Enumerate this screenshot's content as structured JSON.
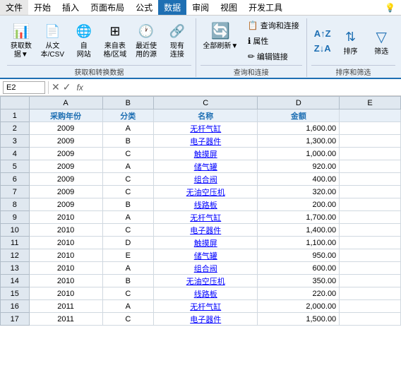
{
  "menubar": {
    "items": [
      "文件",
      "开始",
      "插入",
      "页面布局",
      "公式",
      "数据",
      "审阅",
      "视图",
      "开发工具"
    ]
  },
  "ribbon": {
    "groups": [
      {
        "label": "获取和转换数据",
        "buttons": [
          {
            "id": "get-data",
            "icon": "📊",
            "label": "获取数\n据▼"
          },
          {
            "id": "from-text",
            "icon": "📄",
            "label": "从文\n本/CSV"
          },
          {
            "id": "from-web",
            "icon": "🌐",
            "label": "自\n网站"
          },
          {
            "id": "from-table",
            "icon": "⬜",
            "label": "来自表\n格/区域"
          },
          {
            "id": "recent-sources",
            "icon": "🕐",
            "label": "最近使\n用的源"
          },
          {
            "id": "existing-conn",
            "icon": "🔗",
            "label": "现有\n连接"
          }
        ]
      },
      {
        "label": "查询和连接",
        "buttons": [
          {
            "id": "refresh-all",
            "icon": "🔄",
            "label": "全部刷新\n▼"
          },
          {
            "id": "queries-conn",
            "icon": "📋",
            "label": "查询和连接"
          },
          {
            "id": "properties",
            "icon": "ℹ",
            "label": "属性"
          },
          {
            "id": "edit-links",
            "icon": "✏",
            "label": "编辑链接"
          }
        ]
      },
      {
        "label": "排序和筛选",
        "buttons": [
          {
            "id": "sort-az",
            "icon": "↑",
            "label": "AZ"
          },
          {
            "id": "sort-za",
            "icon": "↓",
            "label": "ZA"
          },
          {
            "id": "sort",
            "icon": "⬛",
            "label": "排序"
          },
          {
            "id": "filter",
            "icon": "▽",
            "label": "筛选"
          }
        ]
      }
    ]
  },
  "formula_bar": {
    "cell_ref": "E2",
    "formula": ""
  },
  "sheet": {
    "col_headers": [
      "",
      "A",
      "B",
      "C",
      "D",
      "E"
    ],
    "rows": [
      {
        "row_num": "1",
        "A": "采购年份",
        "B": "分类",
        "C": "名称",
        "D": "金额",
        "E": "",
        "type": "header"
      },
      {
        "row_num": "2",
        "A": "2009",
        "B": "A",
        "C": "无杆气缸",
        "D": "1,600.00",
        "E": "",
        "type": "data"
      },
      {
        "row_num": "3",
        "A": "2009",
        "B": "B",
        "C": "电子器件",
        "D": "1,300.00",
        "E": "",
        "type": "data"
      },
      {
        "row_num": "4",
        "A": "2009",
        "B": "C",
        "C": "触摸屏",
        "D": "1,000.00",
        "E": "",
        "type": "data"
      },
      {
        "row_num": "5",
        "A": "2009",
        "B": "A",
        "C": "储气罐",
        "D": "920.00",
        "E": "",
        "type": "data"
      },
      {
        "row_num": "6",
        "A": "2009",
        "B": "C",
        "C": "组合阀",
        "D": "400.00",
        "E": "",
        "type": "data"
      },
      {
        "row_num": "7",
        "A": "2009",
        "B": "C",
        "C": "无油空压机",
        "D": "320.00",
        "E": "",
        "type": "data"
      },
      {
        "row_num": "8",
        "A": "2009",
        "B": "B",
        "C": "线路板",
        "D": "200.00",
        "E": "",
        "type": "data"
      },
      {
        "row_num": "9",
        "A": "2010",
        "B": "A",
        "C": "无杆气缸",
        "D": "1,700.00",
        "E": "",
        "type": "data"
      },
      {
        "row_num": "10",
        "A": "2010",
        "B": "C",
        "C": "电子器件",
        "D": "1,400.00",
        "E": "",
        "type": "data"
      },
      {
        "row_num": "11",
        "A": "2010",
        "B": "D",
        "C": "触摸屏",
        "D": "1,100.00",
        "E": "",
        "type": "data"
      },
      {
        "row_num": "12",
        "A": "2010",
        "B": "E",
        "C": "储气罐",
        "D": "950.00",
        "E": "",
        "type": "data"
      },
      {
        "row_num": "13",
        "A": "2010",
        "B": "A",
        "C": "组合阀",
        "D": "600.00",
        "E": "",
        "type": "data"
      },
      {
        "row_num": "14",
        "A": "2010",
        "B": "B",
        "C": "无油空压机",
        "D": "350.00",
        "E": "",
        "type": "data"
      },
      {
        "row_num": "15",
        "A": "2010",
        "B": "C",
        "C": "线路板",
        "D": "220.00",
        "E": "",
        "type": "data"
      },
      {
        "row_num": "16",
        "A": "2011",
        "B": "A",
        "C": "无杆气缸",
        "D": "2,000.00",
        "E": "",
        "type": "data"
      },
      {
        "row_num": "17",
        "A": "2011",
        "B": "C",
        "C": "电子器件",
        "D": "1,500.00",
        "E": "",
        "type": "data"
      }
    ]
  },
  "labels": {
    "menu_active": "数据",
    "cell_ref": "E2",
    "formula_fx": "fx",
    "get_data_btn": "获取数\n据▼",
    "from_text_btn": "从文\n本/CSV",
    "from_web_btn": "自\n网站",
    "from_table_btn": "来自表\n格/区域",
    "recent_src_btn": "最近使\n用的源",
    "existing_conn_btn": "现有\n连接",
    "refresh_all_btn": "全部刷新▼",
    "queries_conn_label": "查询和连接",
    "properties_label": "属性",
    "edit_links_label": "编辑链接",
    "sort_label": "排序",
    "filter_label": "筛选",
    "group1_label": "获取和转换数据",
    "group2_label": "查询和连接",
    "group3_label": "排序和筛选"
  }
}
